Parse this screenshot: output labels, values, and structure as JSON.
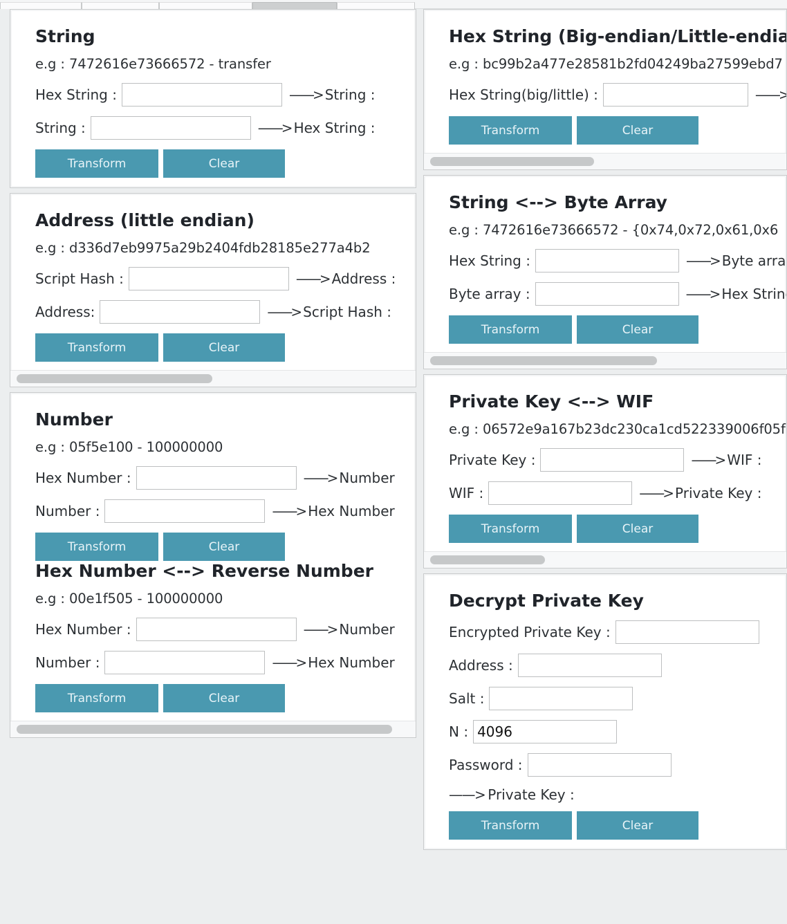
{
  "window": {
    "tabs": [
      {
        "name": "tab-1",
        "active": false
      },
      {
        "name": "tab-2",
        "active": false
      },
      {
        "name": "tab-3",
        "active": false
      },
      {
        "name": "tab-4",
        "active": true
      },
      {
        "name": "tab-5",
        "active": false
      }
    ]
  },
  "common": {
    "transform_label": "Transform",
    "clear_label": "Clear",
    "eg_prefix": "e.g : ",
    "arrow": "——>",
    "input_placeholder": ""
  },
  "colors": {
    "button": "#4a99b0",
    "button_text": "#e8f4f8",
    "panel_background": "#ffffff",
    "page_background": "#eceeef",
    "input_border": "#bdbfc0",
    "scroll_thumb": "#c6c8c9"
  },
  "left_column": {
    "panels": [
      {
        "id": "string",
        "title": "String",
        "example": "e.g : 7472616e73666572 - transfer",
        "rows": [
          {
            "label": "Hex String :",
            "value": "",
            "output": "——> String :",
            "input_width": 232
          },
          {
            "label": "String :",
            "value": "",
            "output": "——> Hex String :",
            "input_width": 232
          }
        ],
        "transform_label": "Transform",
        "clear_label": "Clear",
        "has_scrollbar": false
      },
      {
        "id": "address-little-endian",
        "title": "Address (little endian)",
        "example": "e.g : d336d7eb9975a29b2404fdb28185e277a4b2",
        "rows": [
          {
            "label": "Script Hash :",
            "value": "",
            "output": "——> Address :",
            "input_width": 232
          },
          {
            "label": "Address:",
            "value": "",
            "output": "——> Script Hash :",
            "input_width": 232
          }
        ],
        "transform_label": "Transform",
        "clear_label": "Clear",
        "has_scrollbar": true,
        "scroll_thumb_width": 283
      },
      {
        "id": "number",
        "title": "Number",
        "example": "e.g : 05f5e100 - 100000000",
        "rows": [
          {
            "label": "Hex Number :",
            "value": "",
            "output": "——> Number",
            "input_width": 232
          },
          {
            "label": "Number :",
            "value": "",
            "output": "——> Hex Number",
            "input_width": 232
          }
        ],
        "transform_label": "Transform",
        "clear_label": "Clear",
        "has_scrollbar": false
      },
      {
        "id": "hex-number-reverse-number",
        "title": "Hex Number <--> Reverse Number",
        "example": "e.g : 00e1f505 - 100000000",
        "rows": [
          {
            "label": "Hex Number :",
            "value": "",
            "output": "——> Number",
            "input_width": 232
          },
          {
            "label": "Number :",
            "value": "",
            "output": "——> Hex Number",
            "input_width": 232
          }
        ],
        "transform_label": "Transform",
        "clear_label": "Clear",
        "has_scrollbar": true,
        "scroll_thumb_width": 543
      }
    ]
  },
  "right_column": {
    "panels": [
      {
        "id": "hex-string-endian",
        "title": "Hex String (Big-endian/Little-endian)",
        "example": "e.g : bc99b2a477e28581b2fd04249ba27599ebd7",
        "rows": [
          {
            "label": "Hex String(big/little) :",
            "value": "",
            "output": "——> H",
            "input_width": 210
          }
        ],
        "transform_label": "Transform",
        "clear_label": "Clear",
        "has_scrollbar": true,
        "scroll_thumb_width": 237
      },
      {
        "id": "string-byte-array",
        "title": "String <--> Byte Array",
        "example": "e.g : 7472616e73666572 - {0x74,0x72,0x61,0x6",
        "rows": [
          {
            "label": "Hex String :",
            "value": "",
            "output": "——> Byte array",
            "input_width": 208
          },
          {
            "label": "Byte array :",
            "value": "",
            "output": "——> Hex String",
            "input_width": 208
          }
        ],
        "transform_label": "Transform",
        "clear_label": "Clear",
        "has_scrollbar": true,
        "scroll_thumb_width": 328
      },
      {
        "id": "private-key-wif",
        "title": "Private Key <--> WIF",
        "example": "e.g : 06572e9a167b23dc230ca1cd522339006f05f",
        "rows": [
          {
            "label": "Private Key :",
            "value": "",
            "output": "——> WIF :",
            "input_width": 208
          },
          {
            "label": "WIF :",
            "value": "",
            "output": "——> Private Key :",
            "input_width": 208
          }
        ],
        "transform_label": "Transform",
        "clear_label": "Clear",
        "has_scrollbar": true,
        "scroll_thumb_width": 166
      },
      {
        "id": "decrypt-private-key",
        "title": "Decrypt Private Key",
        "example": "",
        "rows": [
          {
            "label": "Encrypted Private Key :",
            "value": "",
            "output": "",
            "input_width": 208
          },
          {
            "label": "Address :",
            "value": "",
            "output": "",
            "input_width": 208
          },
          {
            "label": "Salt :",
            "value": "",
            "output": "",
            "input_width": 208
          },
          {
            "label": "N :",
            "value": "4096",
            "output": "",
            "input_width": 208
          },
          {
            "label": "Password :",
            "value": "",
            "output": "",
            "input_width": 208
          }
        ],
        "result_line": "——> Private Key :",
        "transform_label": "Transform",
        "clear_label": "Clear",
        "has_scrollbar": false
      }
    ]
  }
}
